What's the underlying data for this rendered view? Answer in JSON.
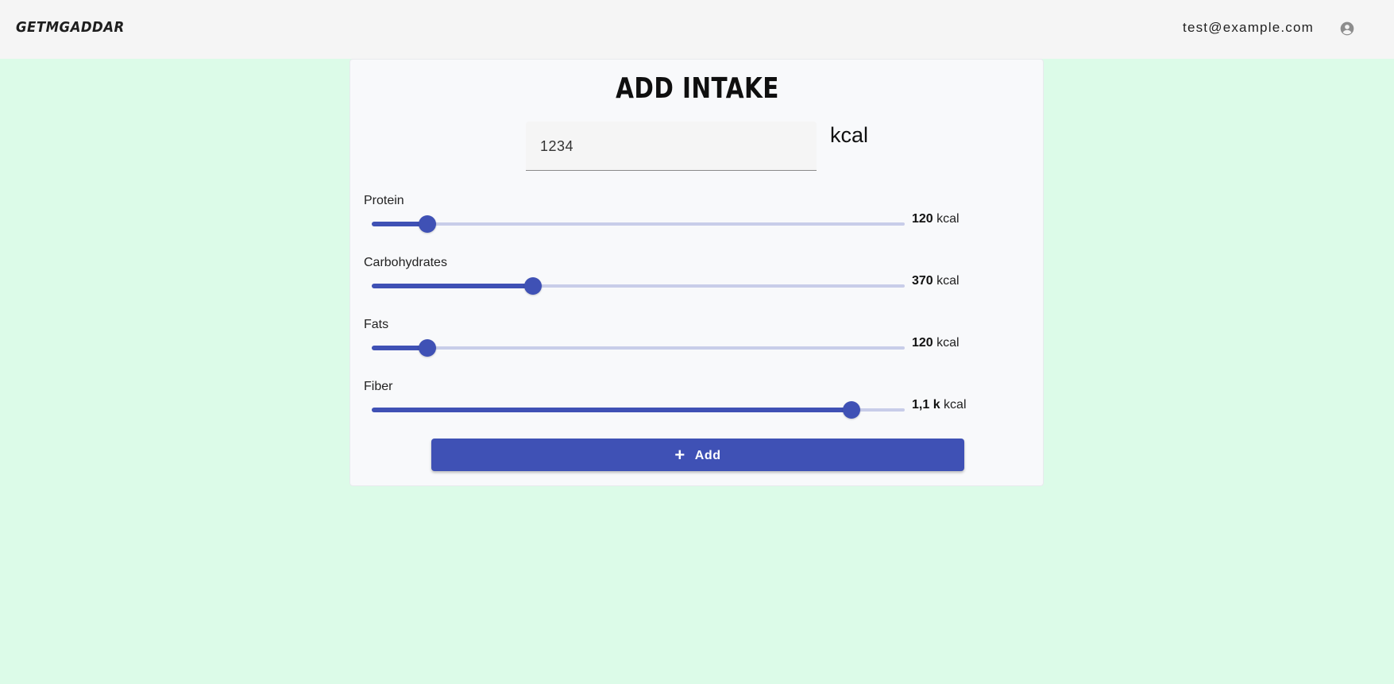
{
  "header": {
    "logo": "GETMGADDAR",
    "user_email": "test@example.com",
    "account_icon": "account-circle-icon"
  },
  "form": {
    "title": "ADD INTAKE",
    "kcal_input_value": "1234",
    "kcal_unit": "kcal",
    "macros": [
      {
        "label": "Protein",
        "value": "120",
        "unit": "kcal",
        "fraction": 0.105
      },
      {
        "label": "Carbohydrates",
        "value": "370",
        "unit": "kcal",
        "fraction": 0.303
      },
      {
        "label": "Fats",
        "value": "120",
        "unit": "kcal",
        "fraction": 0.105
      },
      {
        "label": "Fiber",
        "value": "1,1 k",
        "unit": "kcal",
        "fraction": 0.9
      }
    ],
    "add_button": {
      "icon": "plus-icon",
      "label": "Add"
    }
  },
  "colors": {
    "background": "#dcfbe8",
    "topbar": "#f5f5f5",
    "card": "#f8f9fb",
    "accent": "#3f51b5",
    "track": "#c8cde9"
  }
}
